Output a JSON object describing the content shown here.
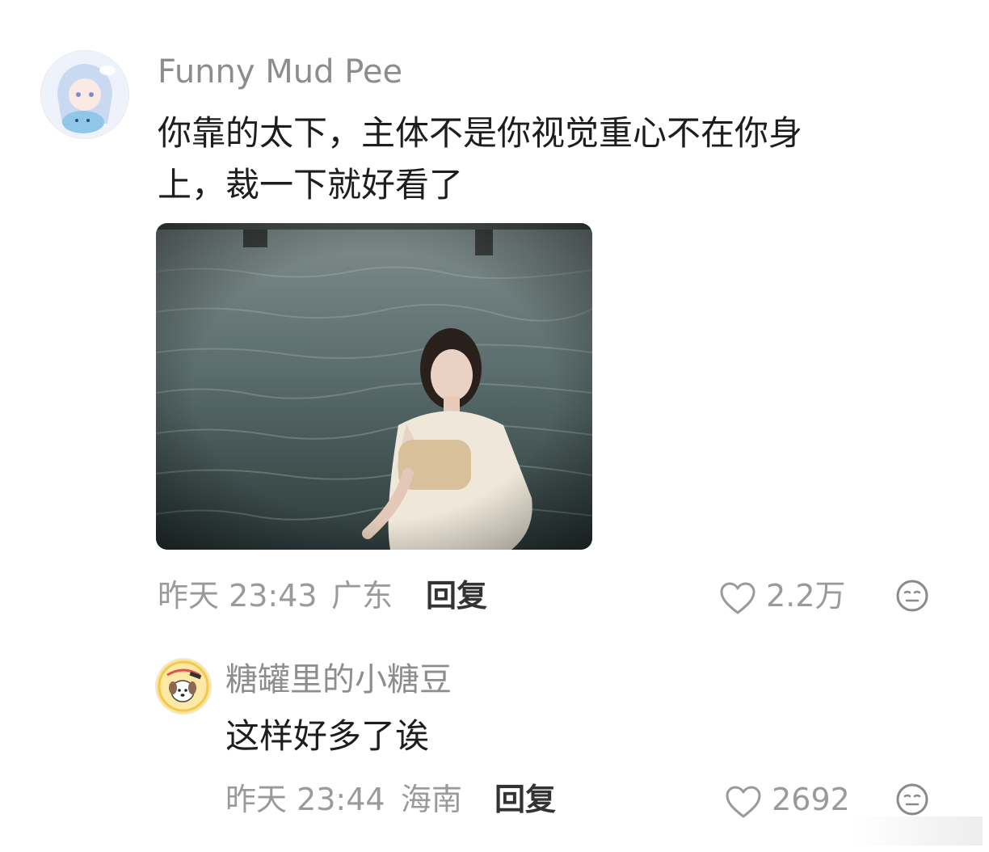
{
  "comments": [
    {
      "username": "Funny Mud Pee",
      "text_line1": "你靠的太下，主体不是你视觉重心不在你身",
      "text_line2": "上，裁一下就好看了",
      "time": "昨天 23:43",
      "location": "广东",
      "reply_label": "回复",
      "likes": "2.2万",
      "avatar_icon": "anime-girl-avatar-icon",
      "has_image": true
    },
    {
      "username": "糖罐里的小糖豆",
      "text_line1": "这样好多了诶",
      "time": "昨天 23:44",
      "location": "海南",
      "reply_label": "回复",
      "likes": "2692",
      "avatar_icon": "cartoon-dog-avatar-icon"
    }
  ],
  "icons": {
    "like": "heart-outline-icon",
    "reaction": "neutral-face-emoji-icon"
  },
  "colors": {
    "username": "#8d8d8d",
    "text": "#1d1d1d",
    "meta": "#9a9a9a"
  }
}
